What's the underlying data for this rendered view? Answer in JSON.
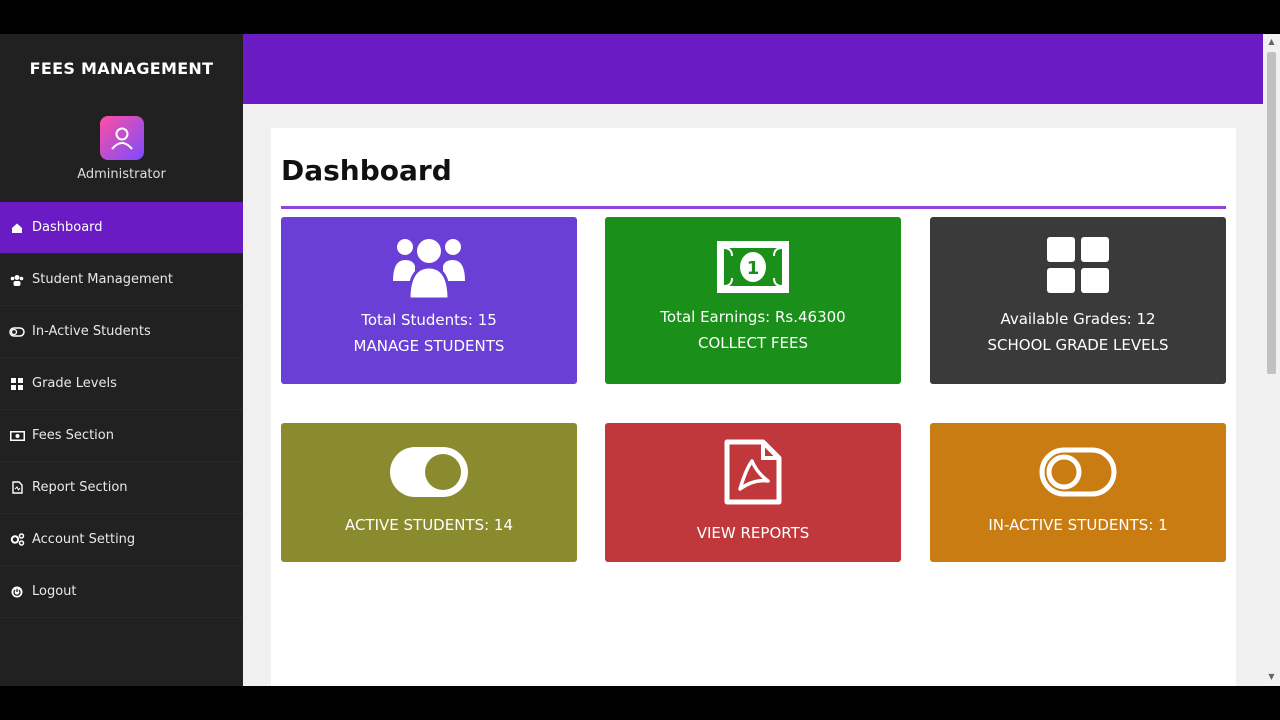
{
  "sidebar": {
    "brand": "FEES MANAGEMENT",
    "role": "Administrator",
    "items": [
      {
        "label": "Dashboard",
        "icon": "home-icon"
      },
      {
        "label": "Student Management",
        "icon": "users-icon"
      },
      {
        "label": "In-Active Students",
        "icon": "toggle-off-icon"
      },
      {
        "label": "Grade Levels",
        "icon": "grid-icon"
      },
      {
        "label": "Fees Section",
        "icon": "money-icon"
      },
      {
        "label": "Report Section",
        "icon": "file-icon"
      },
      {
        "label": "Account Setting",
        "icon": "gears-icon"
      },
      {
        "label": "Logout",
        "icon": "power-icon"
      }
    ]
  },
  "main": {
    "title": "Dashboard",
    "tiles": [
      {
        "line1": "Total Students: 15",
        "line2": "MANAGE STUDENTS",
        "color": "#6a3fd6",
        "icon": "users-icon"
      },
      {
        "line1": "Total Earnings: Rs.46300",
        "line2": "COLLECT FEES",
        "color": "#1a8f1a",
        "icon": "money-bill-icon"
      },
      {
        "line1": "Available Grades: 12",
        "line2": "SCHOOL GRADE LEVELS",
        "color": "#3a3a3a",
        "icon": "grid-icon"
      },
      {
        "line1": "ACTIVE STUDENTS: 14",
        "color": "#8a8a2e",
        "icon": "toggle-on-icon"
      },
      {
        "line1": "VIEW REPORTS",
        "color": "#c0383c",
        "icon": "pdf-file-icon"
      },
      {
        "line1": "IN-ACTIVE STUDENTS: 1",
        "color": "#c87c12",
        "icon": "toggle-off-icon"
      }
    ]
  },
  "colors": {
    "accent": "#6a1bc4",
    "sidebar": "#212121"
  }
}
